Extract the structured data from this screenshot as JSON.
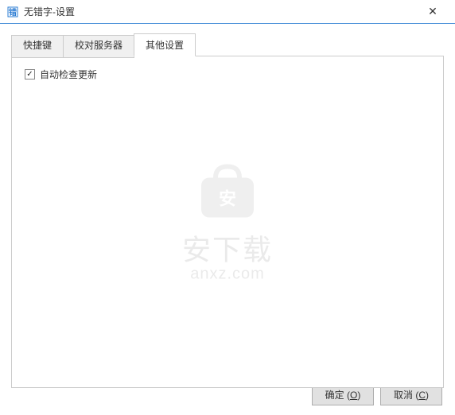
{
  "window": {
    "title": "无错字-设置",
    "close_label": "✕"
  },
  "tabs": {
    "items": [
      {
        "label": "快捷键",
        "active": false
      },
      {
        "label": "校对服务器",
        "active": false
      },
      {
        "label": "其他设置",
        "active": true
      }
    ]
  },
  "panel": {
    "auto_update": {
      "checked": true,
      "mark": "✓",
      "label": "自动检查更新"
    }
  },
  "watermark": {
    "text": "安下载",
    "sub": "anxz.com"
  },
  "buttons": {
    "ok": {
      "label": "确定 (",
      "key": "O",
      "suffix": ")"
    },
    "cancel": {
      "label": "取消 (",
      "key": "C",
      "suffix": ")"
    }
  }
}
